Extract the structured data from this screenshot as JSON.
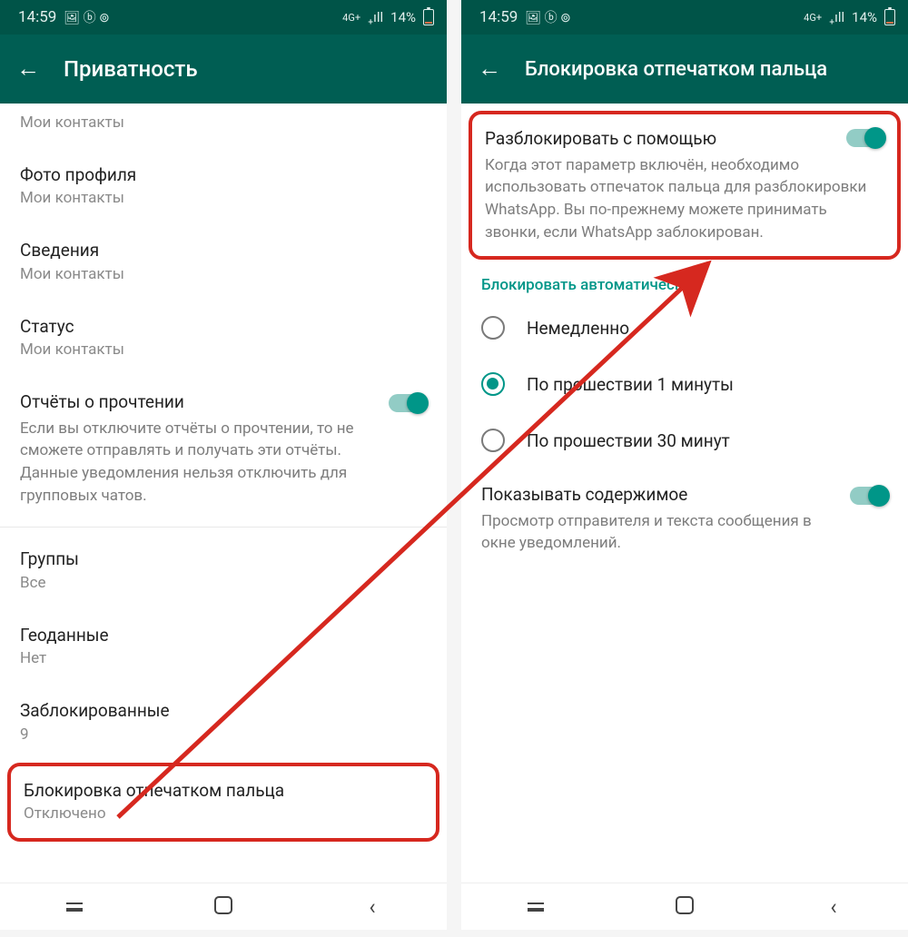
{
  "statusbar": {
    "time": "14:59",
    "left_icons": "🖼 ⓑ ⊚",
    "net_label": "4G+",
    "signal_icons": "₊ıll",
    "battery_pct": "14%"
  },
  "left_screen": {
    "title": "Приватность",
    "items": {
      "my_contacts": "Мои контакты",
      "photo_title": "Фото профиля",
      "photo_sub": "Мои контакты",
      "about_title": "Сведения",
      "about_sub": "Мои контакты",
      "status_title": "Статус",
      "status_sub": "Мои контакты",
      "readreceipts_title": "Отчёты о прочтении",
      "readreceipts_desc": "Если вы отключите отчёты о прочтении, то не сможете отправлять и получать эти отчёты. Данные уведомления нельзя отключить для групповых чатов.",
      "groups_title": "Группы",
      "groups_sub": "Все",
      "livelocation_title": "Геоданные",
      "livelocation_sub": "Нет",
      "blocked_title": "Заблокированные",
      "blocked_sub": "9",
      "fingerprint_title": "Блокировка отпечатком пальца",
      "fingerprint_sub": "Отключено"
    }
  },
  "right_screen": {
    "title": "Блокировка отпечатком пальца",
    "unlock_title": "Разблокировать с помощью",
    "unlock_desc": "Когда этот параметр включён, необходимо использовать отпечаток пальца для разблокировки WhatsApp. Вы по-прежнему можете принимать звонки, если WhatsApp заблокирован.",
    "auto_section": "Блокировать автоматически",
    "radio": {
      "immediately": "Немедленно",
      "after1": "По прошествии 1 минуты",
      "after30": "По прошествии 30 минут"
    },
    "showcontent_title": "Показывать содержимое",
    "showcontent_desc": "Просмотр отправителя и текста сообщения в окне уведомлений."
  }
}
